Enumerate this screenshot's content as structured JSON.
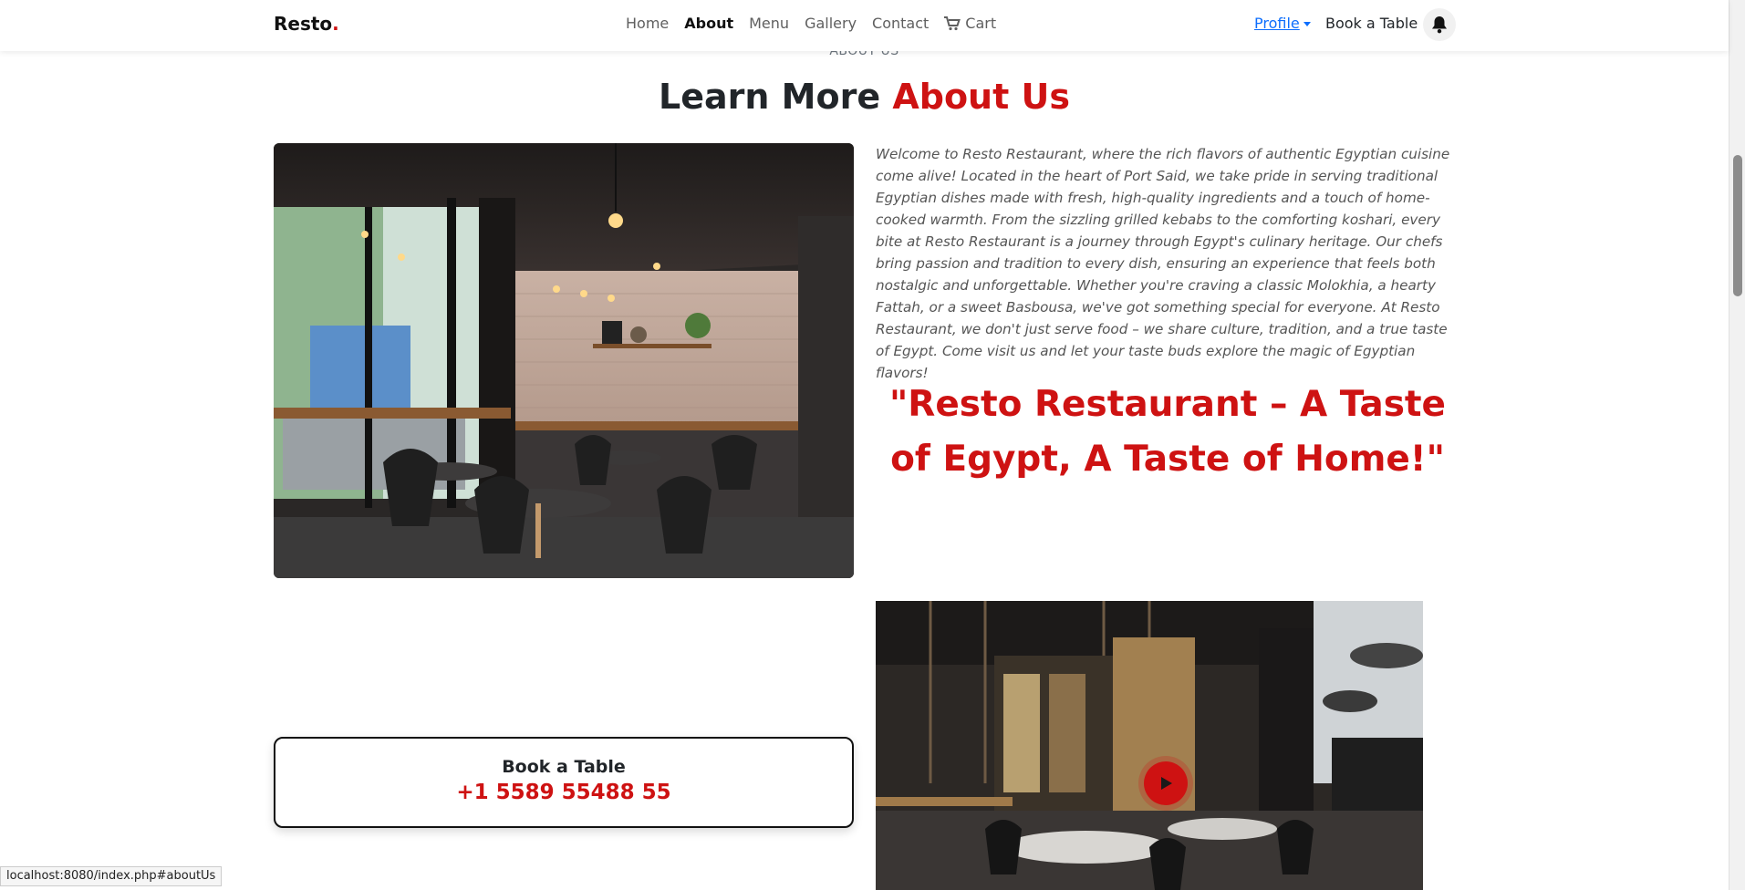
{
  "navbar": {
    "brand": "Resto",
    "brand_dot": ".",
    "links": [
      "Home",
      "About",
      "Menu",
      "Gallery",
      "Contact"
    ],
    "active_link": "About",
    "cart_label": "Cart",
    "profile_label": "Profile",
    "book_label": "Book a Table"
  },
  "section": {
    "subtitle": "ABOUT US",
    "title_main": "Learn More ",
    "title_accent": "About Us"
  },
  "about": {
    "paragraph": "Welcome to Resto Restaurant, where the rich flavors of authentic Egyptian cuisine come alive! Located in the heart of Port Said, we take pride in serving traditional Egyptian dishes made with fresh, high-quality ingredients and a touch of home-cooked warmth. From the sizzling grilled kebabs to the comforting koshari, every bite at Resto Restaurant is a journey through Egypt's culinary heritage. Our chefs bring passion and tradition to every dish, ensuring an experience that feels both nostalgic and unforgettable. Whether you're craving a classic Molokhia, a hearty Fattah, or a sweet Basbousa, we've got something special for everyone. At Resto Restaurant, we don't just serve food – we share culture, tradition, and a true taste of Egypt. Come visit us and let your taste buds explore the magic of Egyptian flavors!",
    "quote": "\"Resto Restaurant – A Taste of Egypt, A Taste of Home!\""
  },
  "book_card": {
    "title": "Book a Table",
    "phone": "+1 5589 55488 55"
  },
  "status_url": "localhost:8080/index.php#aboutUs",
  "colors": {
    "accent": "#ce1212",
    "link": "#0d6efd"
  }
}
